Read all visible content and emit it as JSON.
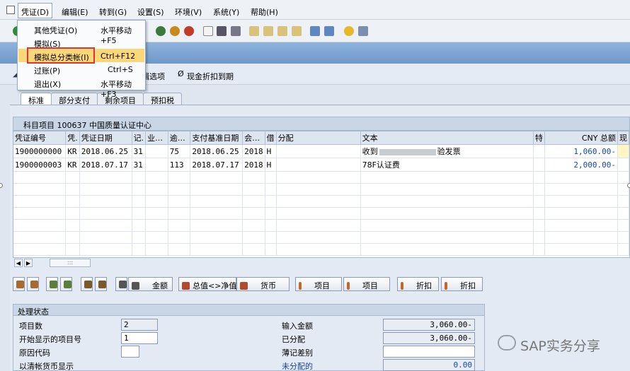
{
  "menubar": {
    "items": [
      "凭证(D)",
      "编辑(E)",
      "转到(G)",
      "设置(S)",
      "环境(V)",
      "系统(Y)",
      "帮助(H)"
    ]
  },
  "dropdown": {
    "items": [
      {
        "label": "其他凭证(O)",
        "shortcut": "水平移动+F5"
      },
      {
        "label": "模拟(S)",
        "shortcut": ""
      },
      {
        "label": "模拟总分类帐(I)",
        "shortcut": "Ctrl+F12"
      },
      {
        "label": "过账(P)",
        "shortcut": "Ctrl+S"
      },
      {
        "label": "退出(X)",
        "shortcut": "水平移动+F3"
      }
    ]
  },
  "appbar": {
    "item1": "辑选项",
    "item2": "现金折扣到期"
  },
  "tabs": [
    "标准",
    "部分支付",
    "剩余项目",
    "预扣税"
  ],
  "section": {
    "title": "科目项目 100637 中国质量认证中心"
  },
  "table": {
    "headers": [
      "凭证编号",
      "凭.",
      "凭证日期",
      "记.",
      "业…",
      "逾…",
      "支付基准日期",
      "会…",
      "借",
      "分配",
      "文本",
      "特",
      "CNY 总额",
      "现"
    ],
    "rows": [
      [
        "1900000000",
        "KR",
        "2018.06.25",
        "31",
        "",
        "75",
        "2018.06.25",
        "2018",
        "H",
        "",
        "收到",
        "验发票",
        "",
        "1,060.00-"
      ],
      [
        "1900000003",
        "KR",
        "2018.07.17",
        "31",
        "",
        "113",
        "2018.07.17",
        "2018",
        "H",
        "",
        "78F认证费",
        "",
        "",
        "2,000.00-"
      ]
    ]
  },
  "buttons": {
    "amount": "金额",
    "net_gross": "总值<>净值",
    "currency": "货币",
    "item_a": "项目",
    "item_b": "项目",
    "discount_a": "折扣",
    "discount_b": "折扣"
  },
  "status": {
    "title": "处理状态",
    "labels": {
      "item_count": "项目数",
      "first_item": "开始显示的项目号",
      "reason": "原因代码",
      "ledger_currency": "以清帐货币显示",
      "entered_amount": "输入金额",
      "assigned": "已分配",
      "posting_diff": "薄记差别",
      "unassigned": "未分配的"
    },
    "values": {
      "item_count": "2",
      "first_item": "1",
      "reason": "",
      "entered_amount": "3,060.00-",
      "assigned": "3,060.00-",
      "posting_diff": "",
      "unassigned": "0.00"
    }
  },
  "watermark": "SAP实务分享",
  "colors": {
    "highlight": "#fbd77a",
    "redbox": "#e03434",
    "amount": "#1646a5"
  }
}
